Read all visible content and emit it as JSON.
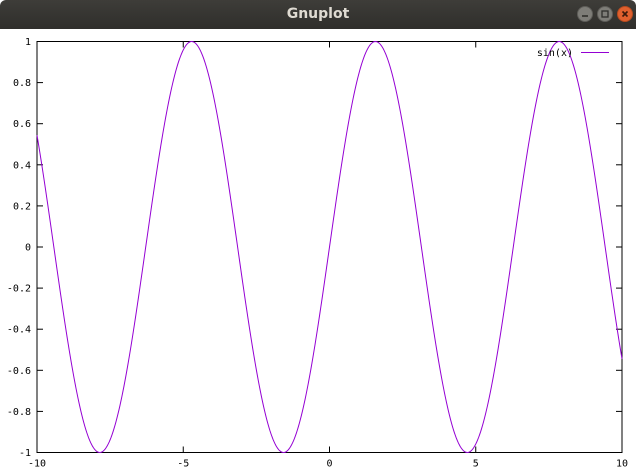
{
  "window": {
    "title": "Gnuplot"
  },
  "chart_data": {
    "type": "line",
    "function": "sin(x)",
    "series": [
      {
        "name": "sin(x)",
        "color": "#9400d3"
      }
    ],
    "xlim": [
      -10,
      10
    ],
    "ylim": [
      -1,
      1
    ],
    "x_ticks": [
      -10,
      -5,
      0,
      5,
      10
    ],
    "y_ticks": [
      -1,
      -0.8,
      -0.6,
      -0.4,
      -0.2,
      0,
      0.2,
      0.4,
      0.6,
      0.8,
      1
    ],
    "x_tick_labels": [
      "-10",
      "-5",
      "0",
      "5",
      "10"
    ],
    "y_tick_labels": [
      "-1",
      "-0.8",
      "-0.6",
      "-0.4",
      "-0.2",
      "0",
      "0.2",
      "0.4",
      "0.6",
      "0.8",
      "1"
    ],
    "legend": {
      "label": "sin(x)",
      "position": "top-right"
    },
    "grid": false
  }
}
